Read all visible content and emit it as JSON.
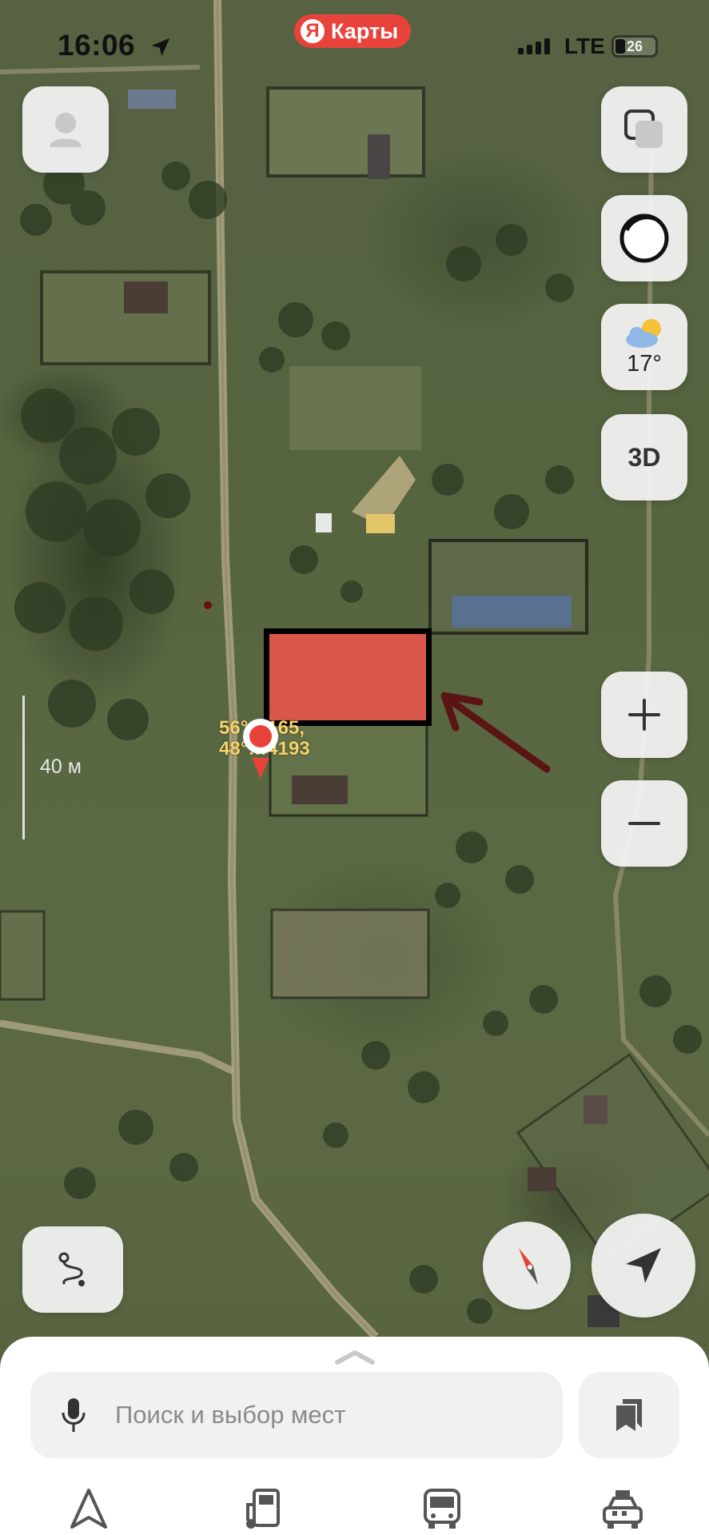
{
  "status_bar": {
    "time": "16:06",
    "network": "LTE",
    "battery": "26"
  },
  "app": {
    "badge_letter": "Я",
    "name": "Карты"
  },
  "map_controls": {
    "weather_temp": "17°",
    "view_3d_label": "3D",
    "zoom_in_symbol": "+",
    "zoom_out_symbol": "−"
  },
  "scale": {
    "label": "40 м"
  },
  "pin": {
    "coords_line1": "56°…165,",
    "coords_line2": "48°…4193"
  },
  "search": {
    "placeholder": "Поиск и выбор мест"
  },
  "tabs": [
    "navigation-icon",
    "gas-station-icon",
    "bus-icon",
    "taxi-icon"
  ],
  "colors": {
    "accent": "#e8433b",
    "overlay_box": "#d9574a",
    "arrow": "#5a1414"
  }
}
